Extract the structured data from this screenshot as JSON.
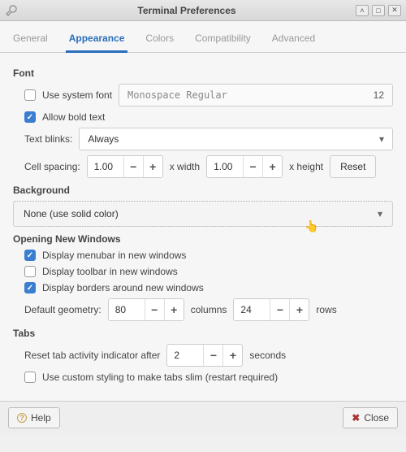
{
  "window": {
    "title": "Terminal Preferences"
  },
  "tabs": [
    "General",
    "Appearance",
    "Colors",
    "Compatibility",
    "Advanced"
  ],
  "active_tab": 1,
  "font": {
    "header": "Font",
    "use_system_font_label": "Use system font",
    "use_system_font_checked": false,
    "font_name": "Monospace Regular",
    "font_size": "12",
    "allow_bold_label": "Allow bold text",
    "allow_bold_checked": true,
    "text_blinks_label": "Text blinks:",
    "text_blinks_value": "Always",
    "cell_spacing_label": "Cell spacing:",
    "cell_width": "1.00",
    "width_label": "x width",
    "cell_height": "1.00",
    "height_label": "x height",
    "reset_label": "Reset"
  },
  "background": {
    "header": "Background",
    "value": "None (use solid color)"
  },
  "new_windows": {
    "header": "Opening New Windows",
    "menubar_label": "Display menubar in new windows",
    "menubar_checked": true,
    "toolbar_label": "Display toolbar in new windows",
    "toolbar_checked": false,
    "borders_label": "Display borders around new windows",
    "borders_checked": true,
    "geometry_label": "Default geometry:",
    "columns": "80",
    "columns_label": "columns",
    "rows": "24",
    "rows_label": "rows"
  },
  "tabs_section": {
    "header": "Tabs",
    "reset_indicator_label": "Reset tab activity indicator after",
    "reset_indicator_value": "2",
    "seconds_label": "seconds",
    "custom_styling_label": "Use custom styling to make tabs slim (restart required)",
    "custom_styling_checked": false
  },
  "footer": {
    "help_label": "Help",
    "close_label": "Close"
  }
}
